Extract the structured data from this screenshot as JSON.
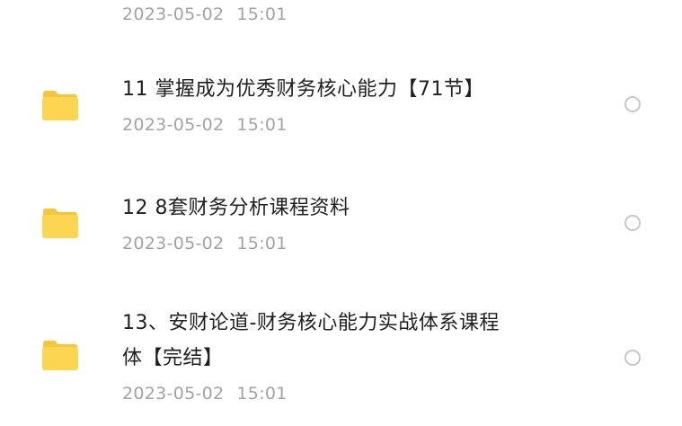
{
  "colors": {
    "folder": "#FCD553",
    "folder_tab": "#F5C63A",
    "title_text": "#1f1f1f",
    "date_text": "#a3a3a3",
    "radio_border": "#c8c8c8"
  },
  "top_partial_item": {
    "date": "2023-05-02",
    "time": "15:01"
  },
  "items": [
    {
      "icon": "folder-icon",
      "title": "11 掌握成为优秀财务核心能力【71节】",
      "date": "2023-05-02",
      "time": "15:01"
    },
    {
      "icon": "folder-icon",
      "title": "12 8套财务分析课程资料",
      "date": "2023-05-02",
      "time": "15:01"
    },
    {
      "icon": "folder-icon",
      "title_line1": "13、安财论道-财务核心能力实战体系课程",
      "title_line2": "体【完结】",
      "date": "2023-05-02",
      "time": "15:01"
    }
  ]
}
